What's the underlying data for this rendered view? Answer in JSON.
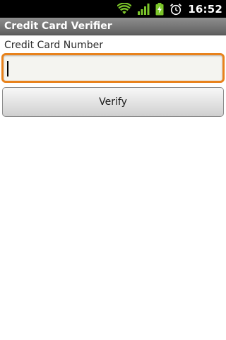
{
  "status_bar": {
    "time": "16:52",
    "icons": [
      "wifi-icon",
      "signal-icon",
      "battery-charging-icon",
      "alarm-clock-icon"
    ],
    "colors": {
      "wifi": "#7cc62a",
      "signal": "#7cc62a",
      "battery": "#7cc62a",
      "alarm": "#ffffff"
    }
  },
  "app": {
    "title": "Credit Card Verifier"
  },
  "form": {
    "card_number_label": "Credit Card Number",
    "card_number_value": "",
    "verify_label": "Verify"
  },
  "colors": {
    "focus_border": "#e8821c",
    "title_bar": "#6f6f6f"
  }
}
